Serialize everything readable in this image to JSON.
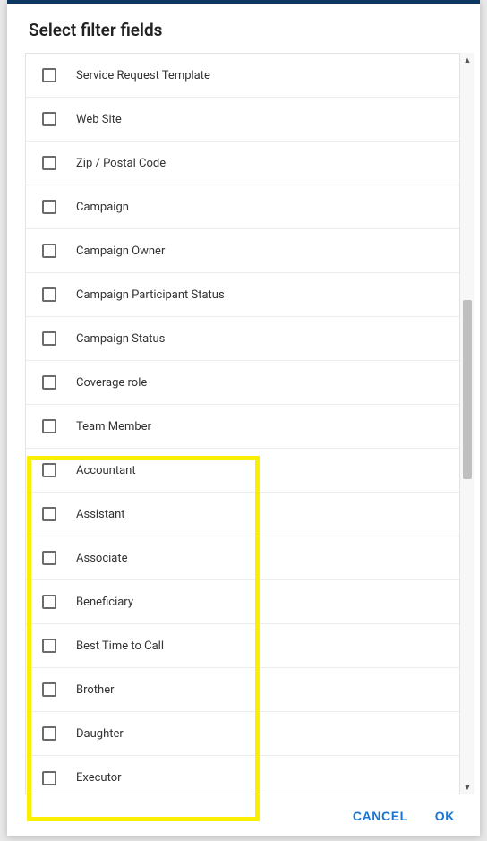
{
  "dialog": {
    "title": "Select filter fields"
  },
  "items": [
    {
      "label": "Service Request Template"
    },
    {
      "label": "Web Site"
    },
    {
      "label": "Zip / Postal Code"
    },
    {
      "label": "Campaign"
    },
    {
      "label": "Campaign Owner"
    },
    {
      "label": "Campaign Participant Status"
    },
    {
      "label": "Campaign Status"
    },
    {
      "label": "Coverage role"
    },
    {
      "label": "Team Member"
    },
    {
      "label": "Accountant"
    },
    {
      "label": "Assistant"
    },
    {
      "label": "Associate"
    },
    {
      "label": "Beneficiary"
    },
    {
      "label": "Best Time to Call"
    },
    {
      "label": "Brother"
    },
    {
      "label": "Daughter"
    },
    {
      "label": "Executor"
    }
  ],
  "footer": {
    "cancel": "CANCEL",
    "ok": "OK"
  }
}
